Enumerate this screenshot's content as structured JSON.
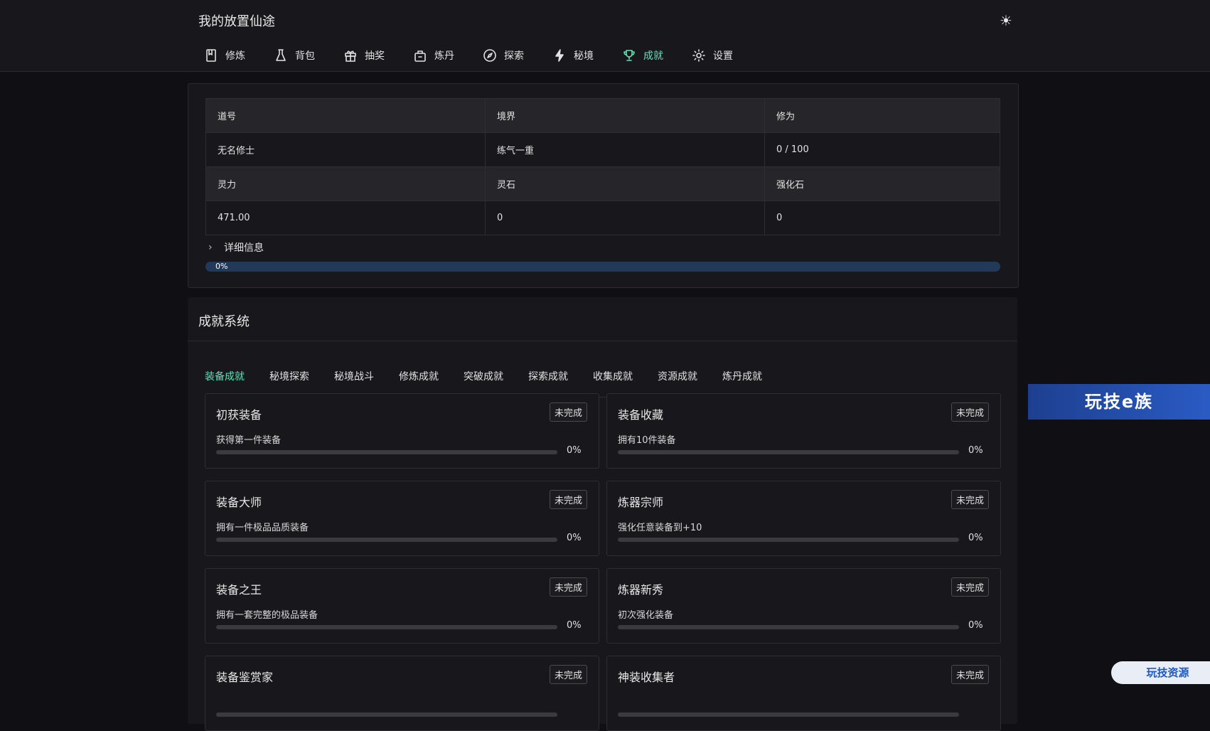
{
  "header": {
    "title": "我的放置仙途",
    "theme_icon": "sun-icon",
    "nav": [
      {
        "label": "修炼",
        "icon": "book-icon",
        "active": false
      },
      {
        "label": "背包",
        "icon": "flask-icon",
        "active": false
      },
      {
        "label": "抽奖",
        "icon": "gift-icon",
        "active": false
      },
      {
        "label": "炼丹",
        "icon": "cauldron-icon",
        "active": false
      },
      {
        "label": "探索",
        "icon": "compass-icon",
        "active": false
      },
      {
        "label": "秘境",
        "icon": "lightning-icon",
        "active": false
      },
      {
        "label": "成就",
        "icon": "trophy-icon",
        "active": true
      },
      {
        "label": "设置",
        "icon": "gear-icon",
        "active": false
      }
    ]
  },
  "stats": {
    "row1_headers": [
      "道号",
      "境界",
      "修为"
    ],
    "row1_values": [
      "无名修士",
      "练气一重",
      "0 / 100"
    ],
    "row2_headers": [
      "灵力",
      "灵石",
      "强化石"
    ],
    "row2_values": [
      "471.00",
      "0",
      "0"
    ],
    "detail_label": "详细信息",
    "progress_percent": 0,
    "progress_label": "0%"
  },
  "achievements": {
    "title": "成就系统",
    "tabs": [
      "装备成就",
      "秘境探索",
      "秘境战斗",
      "修炼成就",
      "突破成就",
      "探索成就",
      "收集成就",
      "资源成就",
      "炼丹成就"
    ],
    "active_tab": 0,
    "items": [
      {
        "name": "初获装备",
        "status": "未完成",
        "desc": "获得第一件装备",
        "progress": 0,
        "pct": "0%"
      },
      {
        "name": "装备收藏",
        "status": "未完成",
        "desc": "拥有10件装备",
        "progress": 0,
        "pct": "0%"
      },
      {
        "name": "装备大师",
        "status": "未完成",
        "desc": "拥有一件极品品质装备",
        "progress": 0,
        "pct": "0%"
      },
      {
        "name": "炼器宗师",
        "status": "未完成",
        "desc": "强化任意装备到+10",
        "progress": 0,
        "pct": "0%"
      },
      {
        "name": "装备之王",
        "status": "未完成",
        "desc": "拥有一套完整的极品装备",
        "progress": 0,
        "pct": "0%"
      },
      {
        "name": "炼器新秀",
        "status": "未完成",
        "desc": "初次强化装备",
        "progress": 0,
        "pct": "0%"
      },
      {
        "name": "装备鉴赏家",
        "status": "未完成",
        "desc": "",
        "progress": 0,
        "pct": ""
      },
      {
        "name": "神装收集者",
        "status": "未完成",
        "desc": "",
        "progress": 0,
        "pct": ""
      }
    ]
  },
  "overlays": {
    "ad_banner": "玩技e族",
    "ad_bottom": "玩技资源"
  },
  "colors": {
    "accent": "#63e2b7",
    "progress_track": "#223a5a",
    "background": "#101014"
  }
}
